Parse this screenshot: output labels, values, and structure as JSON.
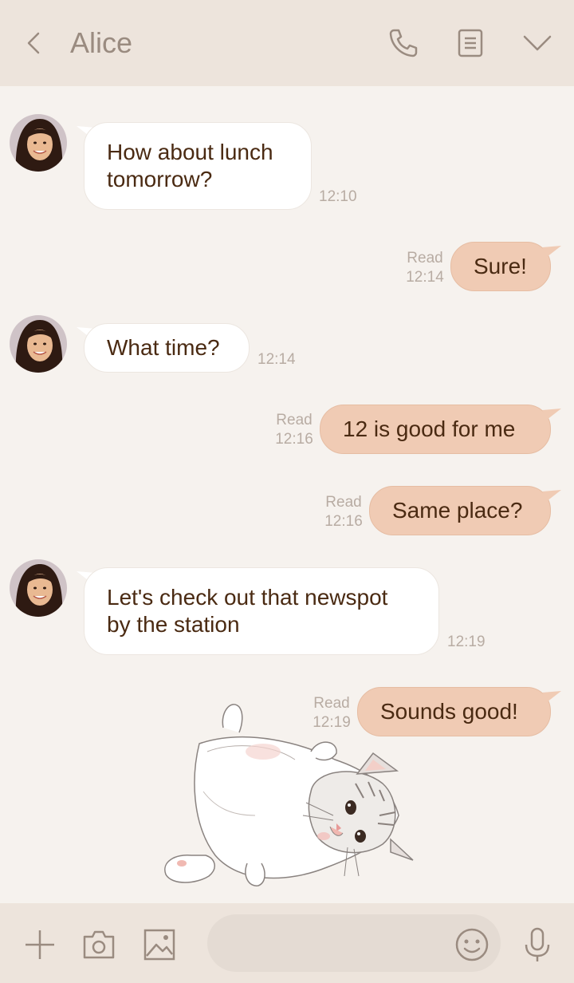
{
  "header": {
    "title": "Alice",
    "icons": [
      "back-icon",
      "phone-icon",
      "notes-icon",
      "chevron-down-icon"
    ]
  },
  "messages": [
    {
      "side": "in",
      "text_lines": [
        "How about lunch",
        "tomorrow?"
      ],
      "time": "12:10"
    },
    {
      "side": "out",
      "text": "Sure!",
      "status": "Read",
      "time": "12:14"
    },
    {
      "side": "in",
      "text": "What time?",
      "time": "12:14"
    },
    {
      "side": "out",
      "text": "12 is good for me",
      "status": "Read",
      "time": "12:16"
    },
    {
      "side": "out",
      "text": "Same place?",
      "status": "Read",
      "time": "12:16"
    },
    {
      "side": "in",
      "text_lines": [
        "Let's check out that newspot",
        "by the station"
      ],
      "time": "12:19"
    },
    {
      "side": "out",
      "text": "Sounds good!",
      "status": "Read",
      "time": "12:19"
    }
  ],
  "sticker": {
    "subject": "sleepy kitten lying on its back"
  },
  "footer": {
    "icons": [
      "plus-icon",
      "camera-icon",
      "image-icon",
      "emoji-icon",
      "microphone-icon"
    ],
    "input_value": ""
  },
  "colors": {
    "background": "#f6f2ee",
    "bar": "#ede4dc",
    "incoming_bubble": "#ffffff",
    "outgoing_bubble": "#f0cbb4",
    "text": "#4a2a12",
    "meta": "#b8aca3"
  }
}
